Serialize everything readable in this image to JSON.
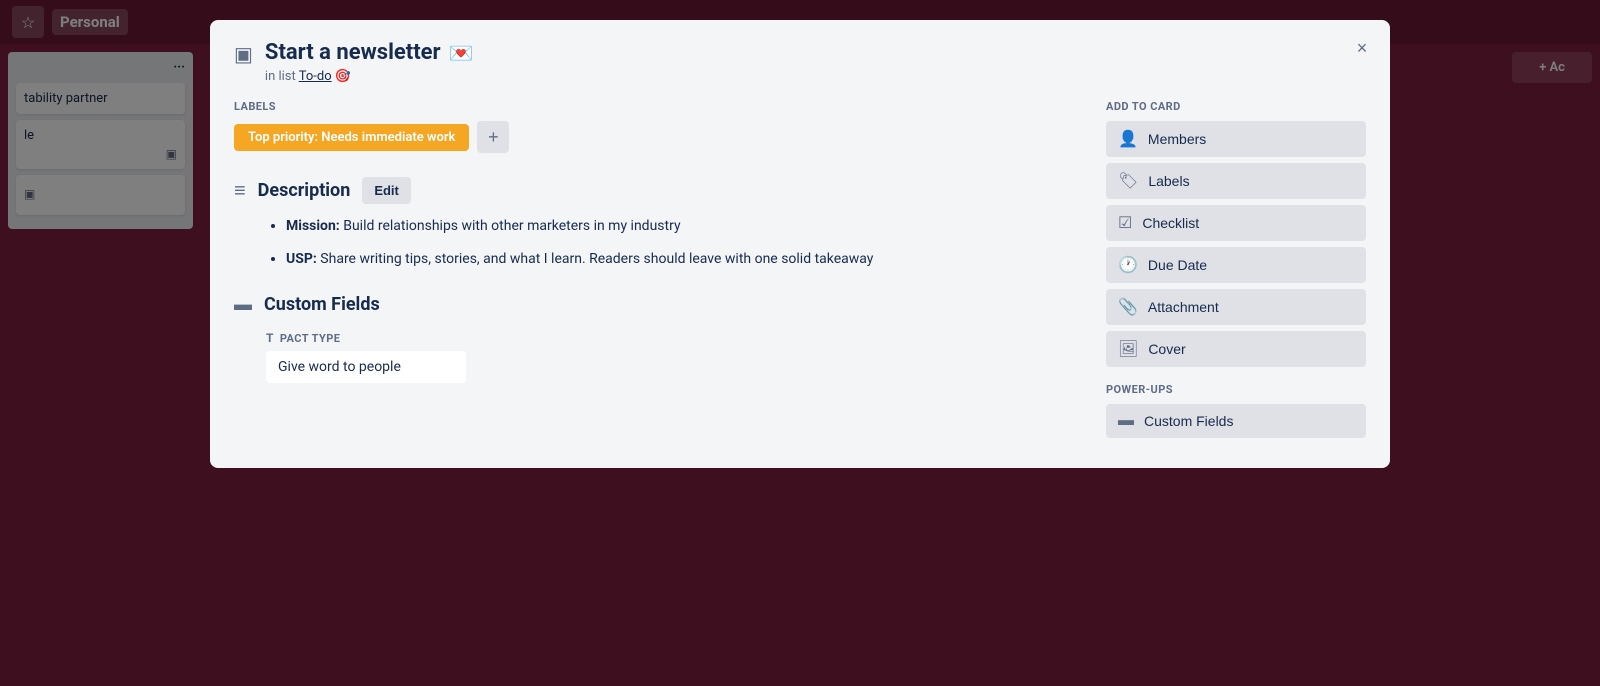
{
  "board": {
    "title": "Personal",
    "bg_list": {
      "title": "",
      "dots": "···",
      "cards": [
        {
          "text": "tability partner"
        },
        {
          "text": "le"
        }
      ]
    },
    "add_list": "+ Ac"
  },
  "modal": {
    "title": "Start a newsletter",
    "title_emoji": "💌",
    "subtitle_prefix": "in list",
    "subtitle_link": "To-do",
    "subtitle_emoji": "🎯",
    "close_label": "×",
    "labels_section": {
      "heading": "Labels",
      "badge_text": "Top priority: Needs immediate work",
      "add_btn": "+"
    },
    "description": {
      "heading": "Description",
      "edit_btn": "Edit",
      "items": [
        {
          "bold": "Mission:",
          "text": " Build relationships with other marketers in my industry"
        },
        {
          "bold": "USP:",
          "text": " Share writing tips, stories, and what I learn. Readers should leave with one solid takeaway"
        }
      ]
    },
    "custom_fields": {
      "heading": "Custom Fields",
      "field_label": "PACT TYPE",
      "field_value": "Give word to people"
    },
    "sidebar": {
      "add_to_card_title": "ADD TO CARD",
      "buttons": [
        {
          "icon": "👤",
          "label": "Members"
        },
        {
          "icon": "🏷",
          "label": "Labels"
        },
        {
          "icon": "☑",
          "label": "Checklist"
        },
        {
          "icon": "🕐",
          "label": "Due Date"
        },
        {
          "icon": "📎",
          "label": "Attachment"
        },
        {
          "icon": "🖼",
          "label": "Cover"
        }
      ],
      "power_ups_title": "POWER-UPS",
      "power_up_buttons": [
        {
          "icon": "▬",
          "label": "Custom Fields"
        }
      ]
    }
  }
}
